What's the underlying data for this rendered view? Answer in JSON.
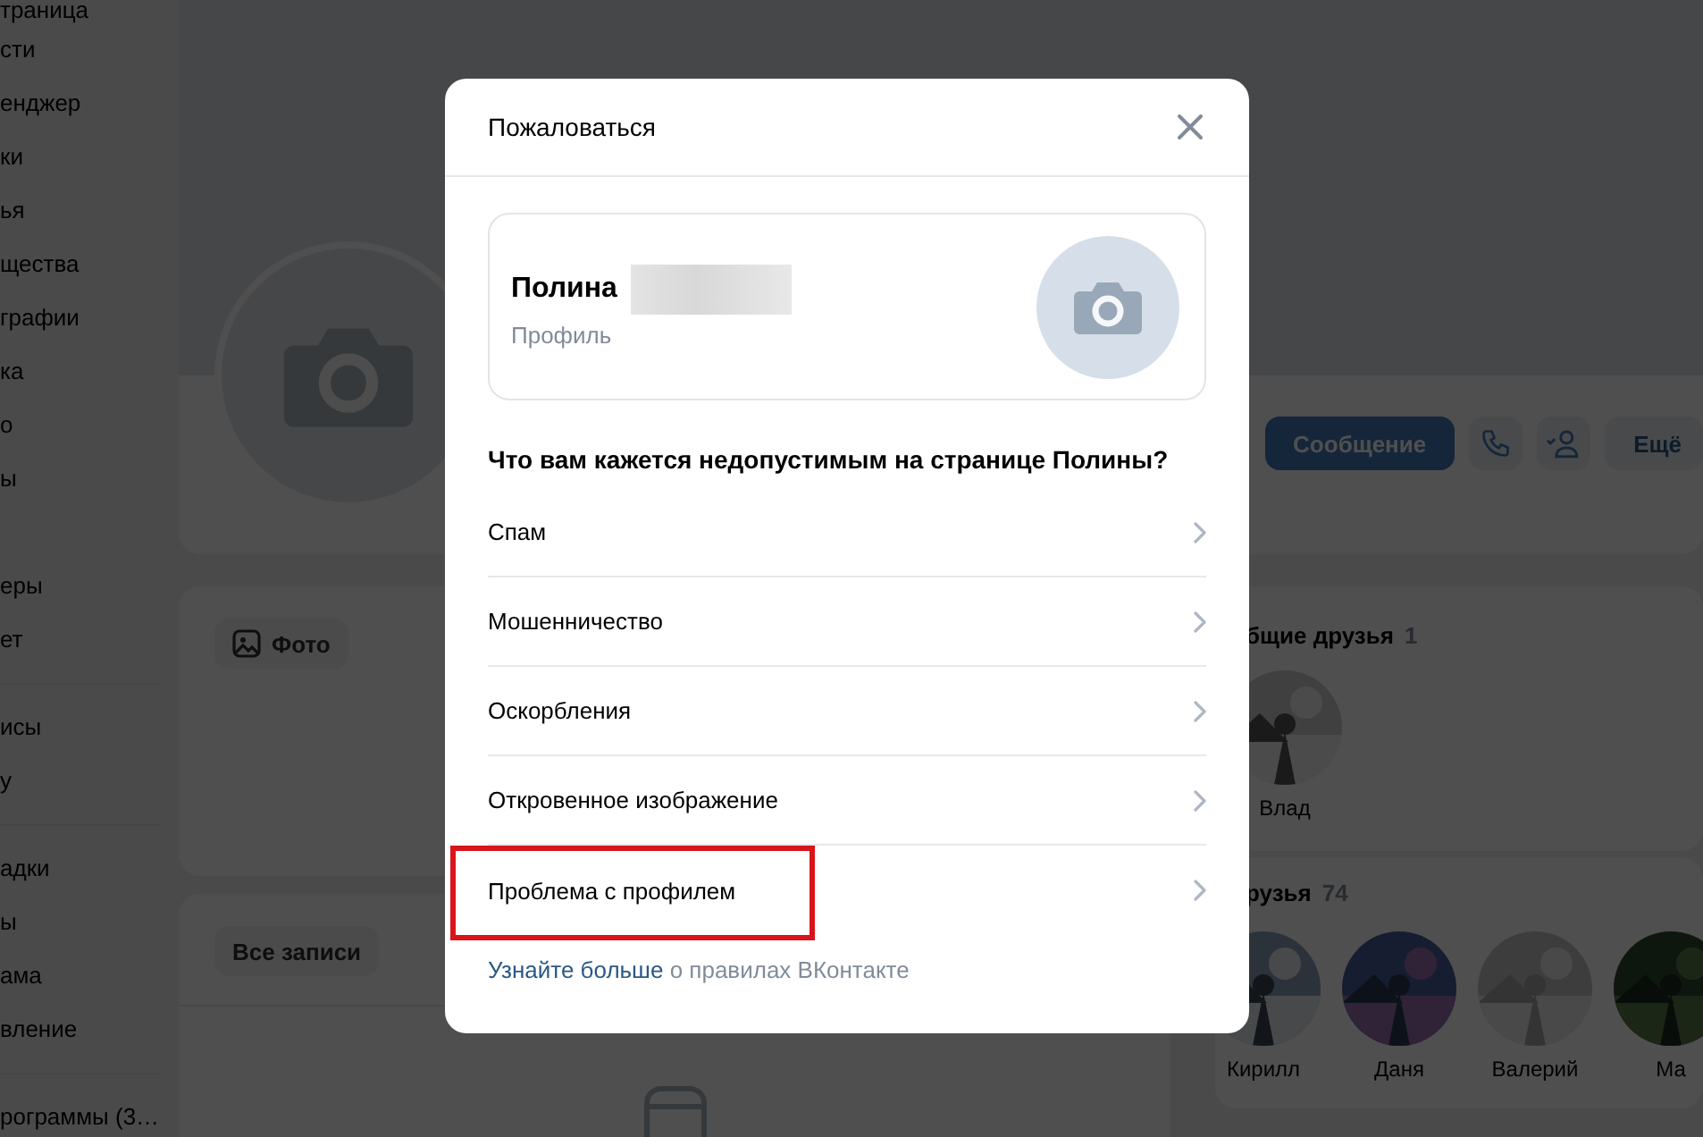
{
  "sidebar": {
    "groups": [
      {
        "items": [
          "траница",
          "сти",
          "енджер",
          "ки",
          "ья",
          "щества",
          "графии",
          "ка",
          "о",
          "ы"
        ]
      },
      {
        "divider": false,
        "items": [
          "еры",
          "ет"
        ]
      },
      {
        "divider": true,
        "items": [
          "исы",
          "у"
        ]
      },
      {
        "divider": true,
        "items": [
          "адки",
          "ы",
          "ама",
          "вление"
        ]
      },
      {
        "divider": true,
        "items": [
          "рограммы (3…"
        ]
      }
    ]
  },
  "profile_actions": [
    {
      "kind": "primary",
      "label": "Сообщение"
    },
    {
      "kind": "phone"
    },
    {
      "kind": "friend"
    },
    {
      "kind": "secondary",
      "label": "Ещё"
    }
  ],
  "photo_card": {
    "button": "Фото"
  },
  "posts_card": {
    "button": "Все записи"
  },
  "mutual_friends": {
    "title": "бщие друзья",
    "count": "1",
    "friends": [
      {
        "name": "Влад"
      }
    ]
  },
  "friends": {
    "title": "рузья",
    "count": "74",
    "friends": [
      {
        "name": "Кирилл"
      },
      {
        "name": "Даня"
      },
      {
        "name": "Валерий"
      },
      {
        "name": "Ма"
      }
    ]
  },
  "dialog": {
    "title": "Пожаловаться",
    "profile": {
      "name": "Полина",
      "subtitle": "Профиль"
    },
    "question": "Что вам кажется недопустимым на странице Полины?",
    "reasons": [
      {
        "label": "Спам",
        "highlighted": false
      },
      {
        "label": "Мошенничество",
        "highlighted": false
      },
      {
        "label": "Оскорбления",
        "highlighted": false
      },
      {
        "label": "Откровенное изображение",
        "highlighted": false
      },
      {
        "label": "Проблема с профилем",
        "highlighted": true
      }
    ],
    "footer": {
      "link": "Узнайте больше",
      "text": "о правилах ВКонтакте"
    }
  }
}
